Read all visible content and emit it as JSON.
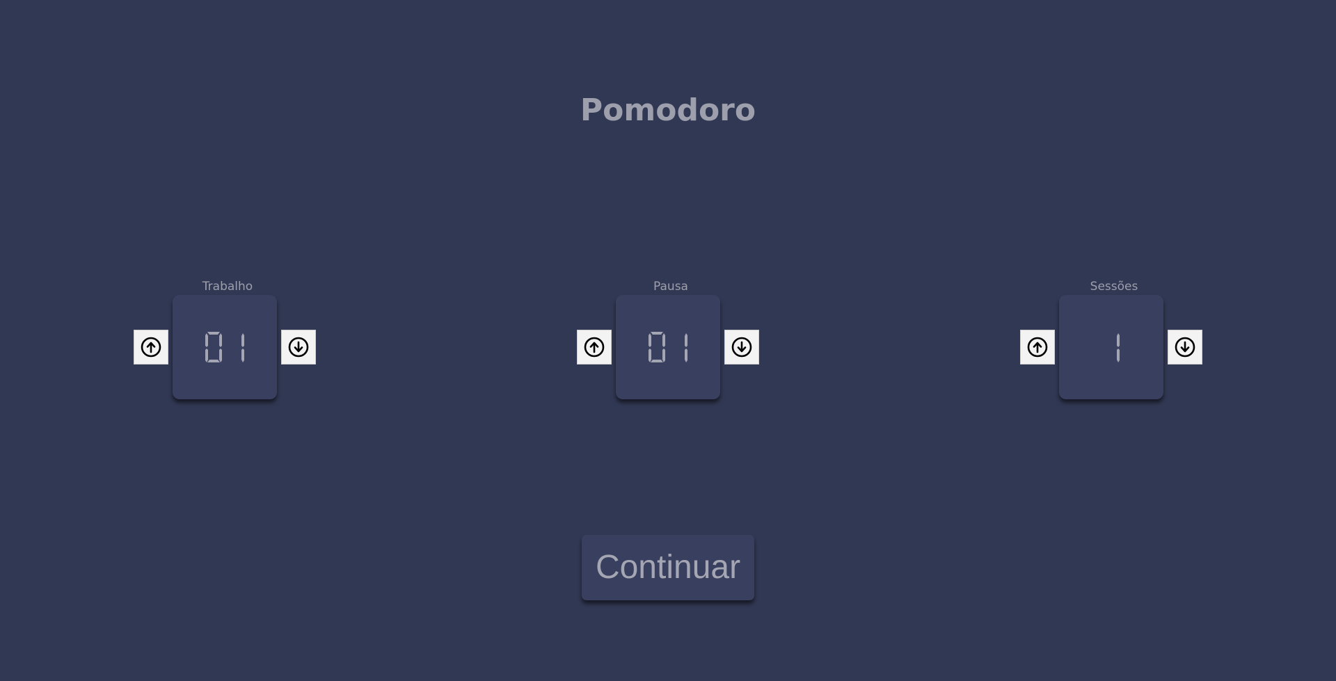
{
  "app": {
    "title": "Pomodoro"
  },
  "settings": [
    {
      "key": "work",
      "label": "Trabalho",
      "value": "01",
      "increment_icon": "arrow-up-circle-icon",
      "decrement_icon": "arrow-down-circle-icon"
    },
    {
      "key": "break",
      "label": "Pausa",
      "value": "01",
      "increment_icon": "arrow-up-circle-icon",
      "decrement_icon": "arrow-down-circle-icon"
    },
    {
      "key": "sessions",
      "label": "Sessões",
      "value": "1",
      "increment_icon": "arrow-up-circle-icon",
      "decrement_icon": "arrow-down-circle-icon"
    }
  ],
  "actions": {
    "continue_label": "Continuar"
  },
  "colors": {
    "background": "#313853",
    "card": "#393f5e",
    "text": "#9e9fad",
    "button": "#f3f3f3"
  }
}
